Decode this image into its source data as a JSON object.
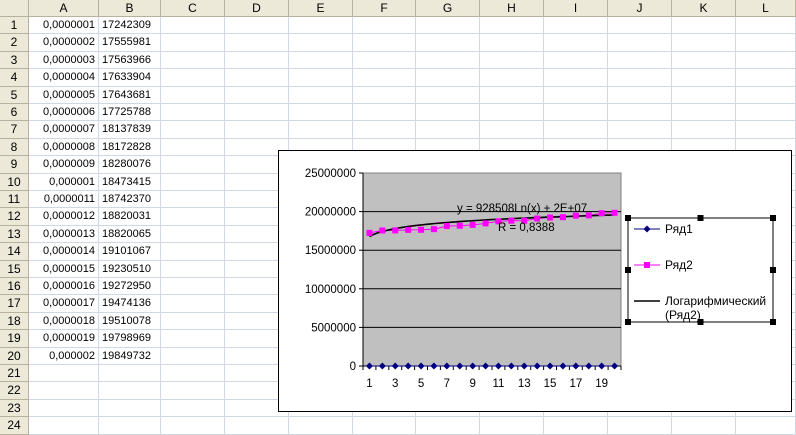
{
  "columns": [
    "A",
    "B",
    "C",
    "D",
    "E",
    "F",
    "G",
    "H",
    "I",
    "J",
    "K",
    "L"
  ],
  "rows": [
    1,
    2,
    3,
    4,
    5,
    6,
    7,
    8,
    9,
    10,
    11,
    12,
    13,
    14,
    15,
    16,
    17,
    18,
    19,
    20,
    21,
    22,
    23,
    24
  ],
  "cells": [
    {
      "a": "0,0000001",
      "b": "17242309"
    },
    {
      "a": "0,0000002",
      "b": "17555981"
    },
    {
      "a": "0,0000003",
      "b": "17563966"
    },
    {
      "a": "0,0000004",
      "b": "17633904"
    },
    {
      "a": "0,0000005",
      "b": "17643681"
    },
    {
      "a": "0,0000006",
      "b": "17725788"
    },
    {
      "a": "0,0000007",
      "b": "18137839"
    },
    {
      "a": "0,0000008",
      "b": "18172828"
    },
    {
      "a": "0,0000009",
      "b": "18280076"
    },
    {
      "a": "0,000001",
      "b": "18473415"
    },
    {
      "a": "0,0000011",
      "b": "18742370"
    },
    {
      "a": "0,0000012",
      "b": "18820031"
    },
    {
      "a": "0,0000013",
      "b": "18820065"
    },
    {
      "a": "0,0000014",
      "b": "19101067"
    },
    {
      "a": "0,0000015",
      "b": "19230510"
    },
    {
      "a": "0,0000016",
      "b": "19272950"
    },
    {
      "a": "0,0000017",
      "b": "19474136"
    },
    {
      "a": "0,0000018",
      "b": "19510078"
    },
    {
      "a": "0,0000019",
      "b": "19798969"
    },
    {
      "a": "0,000002",
      "b": "19849732"
    }
  ],
  "chart_data": {
    "type": "line",
    "x": [
      1,
      2,
      3,
      4,
      5,
      6,
      7,
      8,
      9,
      10,
      11,
      12,
      13,
      14,
      15,
      16,
      17,
      18,
      19,
      20
    ],
    "x_tick_labels": [
      "1",
      "3",
      "5",
      "7",
      "9",
      "11",
      "13",
      "15",
      "17",
      "19"
    ],
    "y_tick_labels": [
      "0",
      "5000000",
      "10000000",
      "15000000",
      "20000000",
      "25000000"
    ],
    "ylim": [
      0,
      25000000
    ],
    "plot_background": "#c0c0c0",
    "gridlines": true,
    "legend_position": "right",
    "series": [
      {
        "name": "Ряд1",
        "color": "#000080",
        "marker": "diamond",
        "values": [
          1e-07,
          2e-07,
          3e-07,
          4e-07,
          5e-07,
          6e-07,
          7e-07,
          8e-07,
          9e-07,
          1e-06,
          1.1e-06,
          1.2e-06,
          1.3e-06,
          1.4e-06,
          1.5e-06,
          1.6e-06,
          1.7e-06,
          1.8e-06,
          1.9e-06,
          2e-06
        ]
      },
      {
        "name": "Ряд2",
        "color": "#ff00ff",
        "marker": "square",
        "values": [
          17242309,
          17555981,
          17563966,
          17633904,
          17643681,
          17725788,
          18137839,
          18172828,
          18280076,
          18473415,
          18742370,
          18820031,
          18820065,
          19101067,
          19230510,
          19272950,
          19474136,
          19510078,
          19798969,
          19849732
        ]
      },
      {
        "name": "Логарифмический (Ряд2)",
        "color": "#000000",
        "type": "trendline",
        "a": 928508,
        "b": 16780000
      }
    ],
    "annotations": {
      "equation": "y = 928508Ln(x) + 2E+07",
      "r_squared": "R  = 0,8388"
    },
    "legend": {
      "series1": "Ряд1",
      "series2": "Ряд2",
      "trend_line1": "Логарифмический",
      "trend_line2": "(Ряд2)"
    }
  }
}
